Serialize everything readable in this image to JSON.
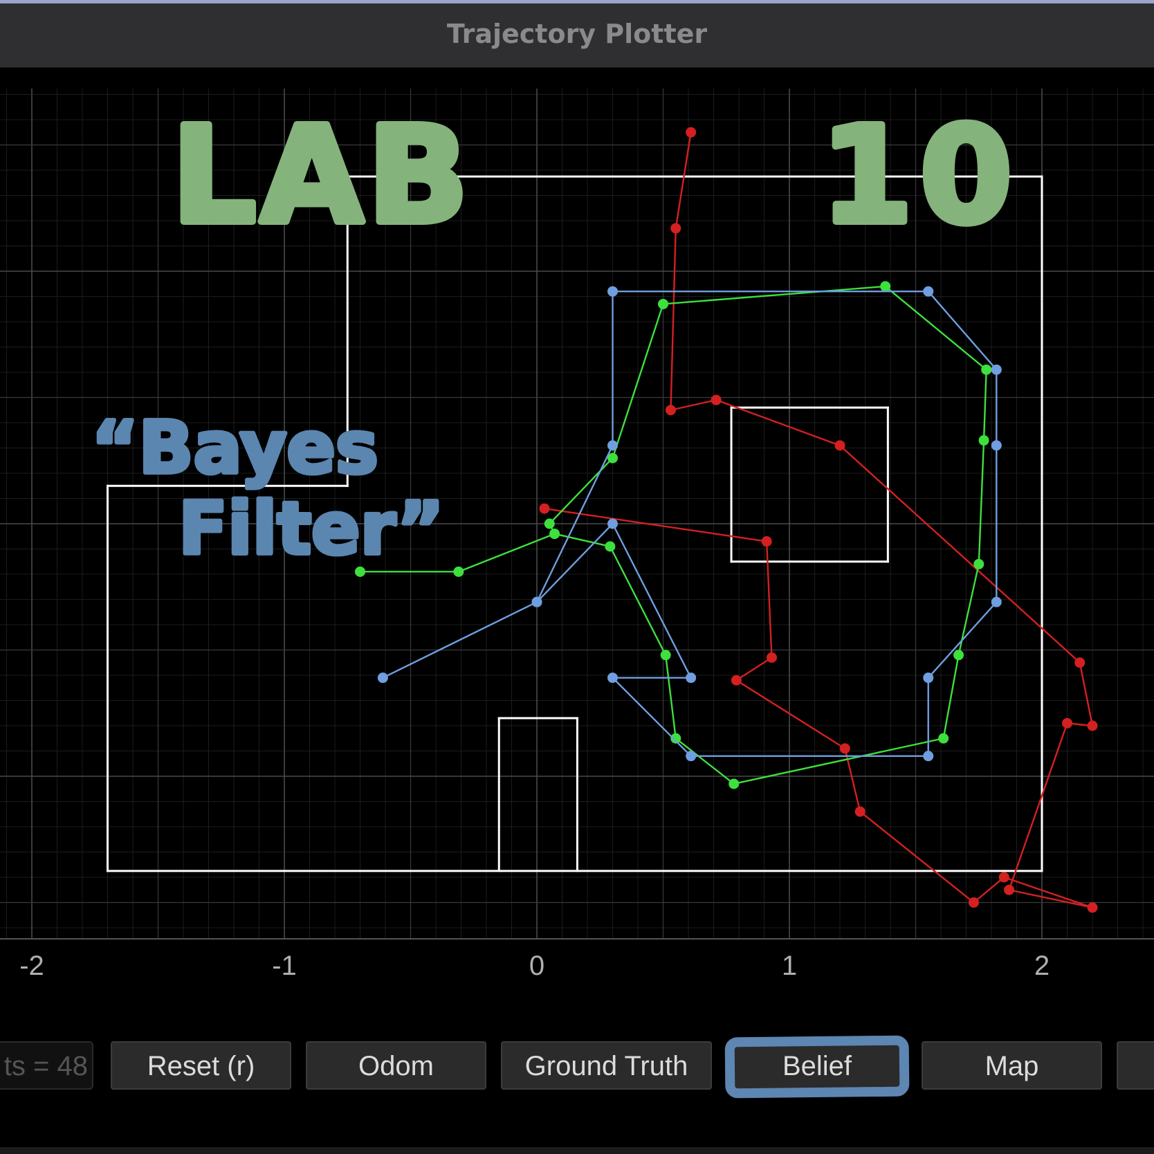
{
  "window": {
    "title": "Trajectory Plotter"
  },
  "annotations": {
    "lab_title": "LAB",
    "lab_number": "10",
    "subtitle_line1": "“Bayes",
    "subtitle_line2": "Filter”"
  },
  "toolbar": {
    "points_field": "ts = 48",
    "reset_label": "Reset (r)",
    "odom_label": "Odom",
    "ground_truth_label": "Ground Truth",
    "belief_label": "Belief",
    "map_label": "Map"
  },
  "chart_data": {
    "type": "line",
    "xlim": [
      -2.13,
      2.45
    ],
    "ylim": [
      -2.2,
      1.7
    ],
    "x_ticks": [
      -2,
      -1,
      0,
      1,
      2
    ],
    "x_tick_labels": [
      "-2",
      "-1",
      "0",
      "1",
      "2"
    ],
    "y_gridlines": [
      -2,
      -1.5,
      -1,
      -0.5,
      0,
      0.5,
      1,
      1.5
    ],
    "grid": true,
    "colors": {
      "odom": "#d42020",
      "ground_truth": "#3de03d",
      "belief": "#6f9fe0",
      "map": "#ffffff",
      "grid_major": "#3a3a3a",
      "grid_minor": "#1d1d1d"
    },
    "map_segments": [
      [
        [
          -1.7,
          -1.375
        ],
        [
          2.0,
          -1.375
        ]
      ],
      [
        [
          2.0,
          -1.375
        ],
        [
          2.0,
          1.375
        ]
      ],
      [
        [
          2.0,
          1.375
        ],
        [
          -0.75,
          1.375
        ]
      ],
      [
        [
          -0.75,
          1.375
        ],
        [
          -0.75,
          0.15
        ]
      ],
      [
        [
          -0.75,
          0.15
        ],
        [
          -1.7,
          0.15
        ]
      ],
      [
        [
          -1.7,
          0.15
        ],
        [
          -1.7,
          -1.375
        ]
      ],
      [
        [
          0.77,
          0.46
        ],
        [
          1.39,
          0.46
        ]
      ],
      [
        [
          1.39,
          0.46
        ],
        [
          1.39,
          -0.15
        ]
      ],
      [
        [
          1.39,
          -0.15
        ],
        [
          0.77,
          -0.15
        ]
      ],
      [
        [
          0.77,
          -0.15
        ],
        [
          0.77,
          0.46
        ]
      ],
      [
        [
          -0.15,
          -1.375
        ],
        [
          -0.15,
          -0.77
        ]
      ],
      [
        [
          -0.15,
          -0.77
        ],
        [
          0.16,
          -0.77
        ]
      ],
      [
        [
          0.16,
          -0.77
        ],
        [
          0.16,
          -1.375
        ]
      ]
    ],
    "series": [
      {
        "key": "odom",
        "points": [
          [
            0.61,
            1.55
          ],
          [
            0.55,
            1.17
          ],
          [
            0.53,
            0.45
          ],
          [
            0.71,
            0.49
          ],
          [
            1.2,
            0.31
          ],
          [
            2.15,
            -0.55
          ],
          [
            2.2,
            -0.8
          ],
          [
            2.1,
            -0.79
          ],
          [
            1.87,
            -1.45
          ],
          [
            2.2,
            -1.52
          ],
          [
            1.85,
            -1.4
          ],
          [
            1.73,
            -1.5
          ],
          [
            1.28,
            -1.14
          ],
          [
            1.22,
            -0.89
          ],
          [
            0.79,
            -0.62
          ],
          [
            0.93,
            -0.53
          ],
          [
            0.91,
            -0.07
          ],
          [
            0.03,
            0.06
          ]
        ]
      },
      {
        "key": "ground_truth",
        "points": [
          [
            -0.7,
            -0.19
          ],
          [
            -0.31,
            -0.19
          ],
          [
            0.07,
            -0.04
          ],
          [
            0.05,
            0.0
          ],
          [
            0.3,
            0.26
          ],
          [
            0.5,
            0.87
          ],
          [
            1.38,
            0.94
          ],
          [
            1.78,
            0.61
          ],
          [
            1.77,
            0.33
          ],
          [
            1.75,
            -0.16
          ],
          [
            1.67,
            -0.52
          ],
          [
            1.61,
            -0.85
          ],
          [
            0.78,
            -1.03
          ],
          [
            0.55,
            -0.85
          ],
          [
            0.51,
            -0.52
          ],
          [
            0.29,
            -0.09
          ],
          [
            0.07,
            -0.04
          ]
        ]
      },
      {
        "key": "belief",
        "points": [
          [
            -0.61,
            -0.61
          ],
          [
            0.0,
            -0.31
          ],
          [
            0.3,
            0.31
          ],
          [
            0.3,
            0.92
          ],
          [
            1.55,
            0.92
          ],
          [
            1.82,
            0.61
          ],
          [
            1.82,
            0.31
          ],
          [
            1.82,
            -0.31
          ],
          [
            1.55,
            -0.61
          ],
          [
            1.55,
            -0.92
          ],
          [
            0.61,
            -0.92
          ],
          [
            0.3,
            -0.61
          ],
          [
            0.61,
            -0.61
          ],
          [
            0.3,
            0.0
          ],
          [
            0.0,
            -0.31
          ]
        ]
      }
    ]
  }
}
